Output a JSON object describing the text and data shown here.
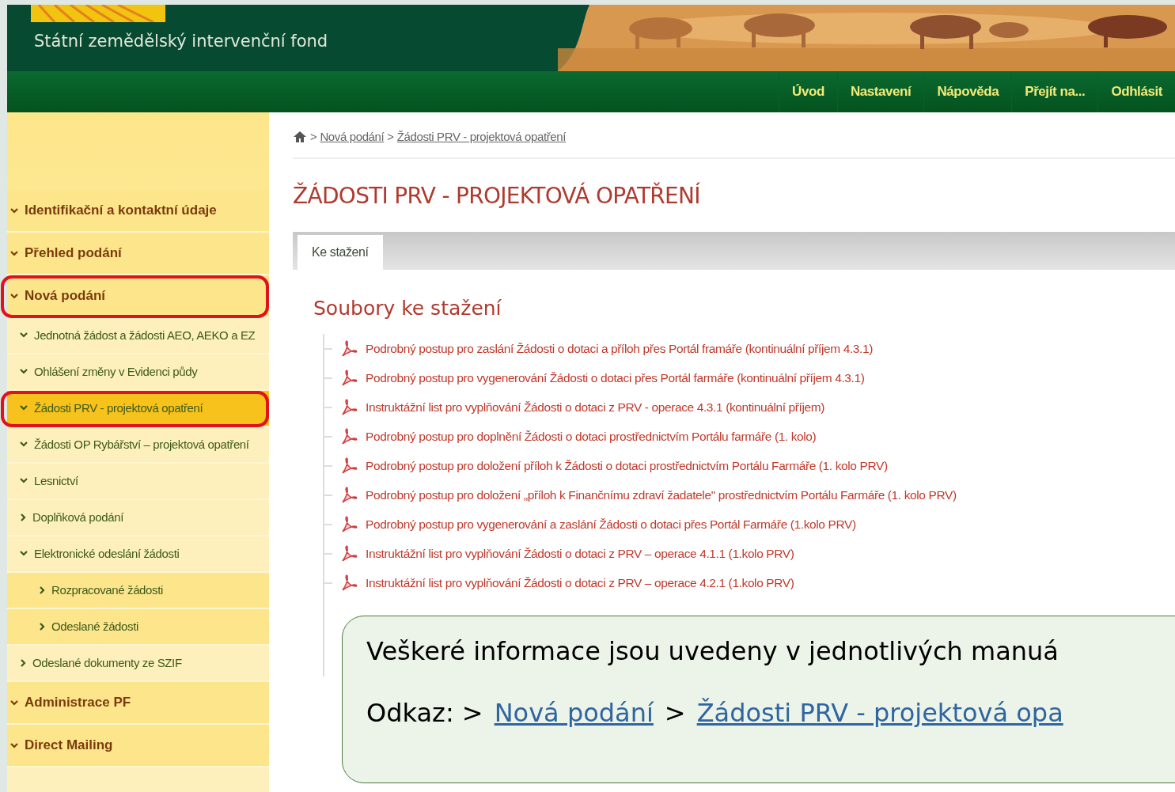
{
  "header": {
    "subtitle": "Státní zemědělský intervenční fond"
  },
  "nav": [
    "Úvod",
    "Nastavení",
    "Nápověda",
    "Přejít na...",
    "Odhlásit"
  ],
  "sidebar": {
    "items": [
      {
        "label": "Identifikační a kontaktní údaje",
        "expanded": true,
        "selected": false,
        "circled": false
      },
      {
        "label": "Přehled podání",
        "expanded": true,
        "selected": false,
        "circled": false
      },
      {
        "label": "Nová podání",
        "expanded": true,
        "selected": false,
        "circled": true,
        "children": [
          {
            "label": "Jednotná žádost a žádosti AEO, AEKO a EZ",
            "expanded": true,
            "selected": false,
            "circled": false
          },
          {
            "label": "Ohlášení změny v Evidenci půdy",
            "expanded": true,
            "selected": false,
            "circled": false
          },
          {
            "label": "Žádosti PRV - projektová opatření",
            "expanded": true,
            "selected": true,
            "circled": true
          },
          {
            "label": "Žádosti OP Rybářství – projektová opatření",
            "expanded": true,
            "selected": false,
            "circled": false
          },
          {
            "label": "Lesnictví",
            "expanded": true,
            "selected": false,
            "circled": false
          },
          {
            "label": "Doplňková podání",
            "expanded": false,
            "selected": false,
            "circled": false
          },
          {
            "label": "Elektronické odeslání žádosti",
            "expanded": true,
            "selected": false,
            "circled": false,
            "children": [
              {
                "label": "Rozpracované žádosti",
                "expanded": false,
                "selected": false,
                "circled": false
              },
              {
                "label": "Odeslané žádosti",
                "expanded": false,
                "selected": false,
                "circled": false
              }
            ]
          },
          {
            "label": "Odeslané dokumenty ze SZIF",
            "expanded": false,
            "selected": false,
            "circled": false
          }
        ]
      },
      {
        "label": "Administrace PF",
        "expanded": true,
        "selected": false,
        "circled": false
      },
      {
        "label": "Direct Mailing",
        "expanded": true,
        "selected": false,
        "circled": false
      }
    ]
  },
  "breadcrumb": {
    "separator": ">",
    "links": [
      "Nová podání",
      "Žádosti PRV - projektová opatření"
    ]
  },
  "title": "ŽÁDOSTI PRV - PROJEKTOVÁ OPATŘENÍ",
  "tabs": [
    {
      "label": "Ke stažení",
      "selected": true
    }
  ],
  "section_title": "Soubory ke stažení",
  "files": [
    "Podrobný postup pro zaslání Žádosti o dotaci a příloh přes Portál framáře (kontinuální příjem 4.3.1)",
    "Podrobný postup pro vygenerování Žádosti o dotaci přes Portál farmáře (kontinuální příjem 4.3.1)",
    "Instruktážní list pro vyplňování Žádosti o dotaci z PRV - operace 4.3.1 (kontinuální příjem)",
    "Podrobný postup pro doplnění Žádosti o dotaci prostřednictvím Portálu farmáře (1. kolo)",
    "Podrobný postup pro doložení příloh k Žádosti o dotaci prostřednictvím Portálu Farmáře (1. kolo PRV)",
    "Podrobný postup pro doložení „příloh k Finančnímu zdraví žadatele\" prostřednictvím Portálu Farmáře (1. kolo PRV)",
    "Podrobný postup pro vygenerování a zaslání Žádosti o dotaci přes Portál Farmáře (1.kolo PRV)",
    "Instruktážní list pro vyplňování Žádosti o dotaci z PRV – operace 4.1.1 (1.kolo PRV)",
    "Instruktážní list pro vyplňování Žádosti o dotaci z PRV – operace 4.2.1 (1.kolo PRV)"
  ],
  "callout": {
    "text": "Veškeré informace jsou uvedeny v jednotlivých manuá",
    "prefix": "Odkaz: >",
    "links": [
      "Nová podání",
      "Žádosti PRV - projektová opa"
    ],
    "separator": ">"
  }
}
